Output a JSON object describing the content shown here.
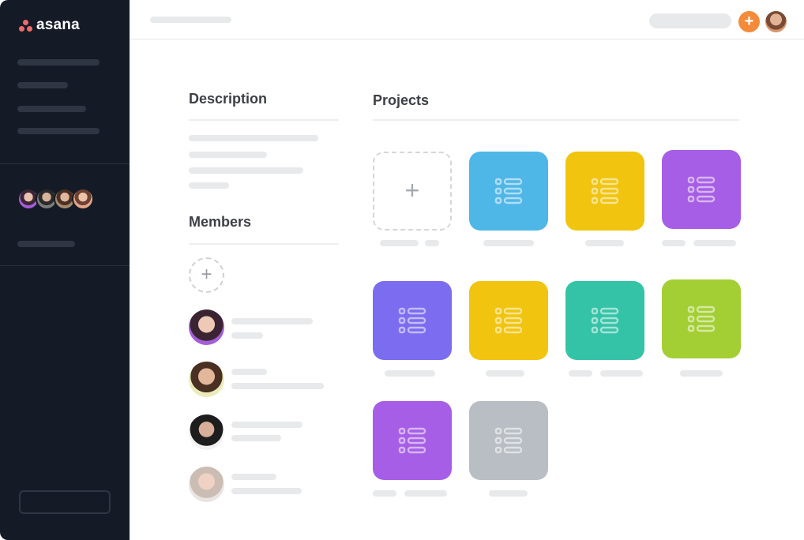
{
  "app": {
    "logo_text": "asana",
    "brand_color": "#f06a6a"
  },
  "topbar": {
    "add_icon": "+",
    "add_color": "#f48b3a"
  },
  "description": {
    "title": "Description"
  },
  "members": {
    "title": "Members",
    "add_icon": "+"
  },
  "projects": {
    "title": "Projects",
    "add_icon": "+",
    "tiles": [
      {
        "color": "#4fb6e8",
        "icon": "list-icon"
      },
      {
        "color": "#f1c40f",
        "icon": "list-icon"
      },
      {
        "color": "#a65ee6",
        "icon": "list-icon"
      },
      {
        "color": "#7b6cf0",
        "icon": "list-icon"
      },
      {
        "color": "#f1c40f",
        "icon": "list-icon"
      },
      {
        "color": "#35c3a7",
        "icon": "list-icon"
      },
      {
        "color": "#a3cf34",
        "icon": "list-icon"
      },
      {
        "color": "#a65ee6",
        "icon": "list-icon"
      },
      {
        "color": "#b9bec5",
        "icon": "list-icon"
      }
    ]
  }
}
